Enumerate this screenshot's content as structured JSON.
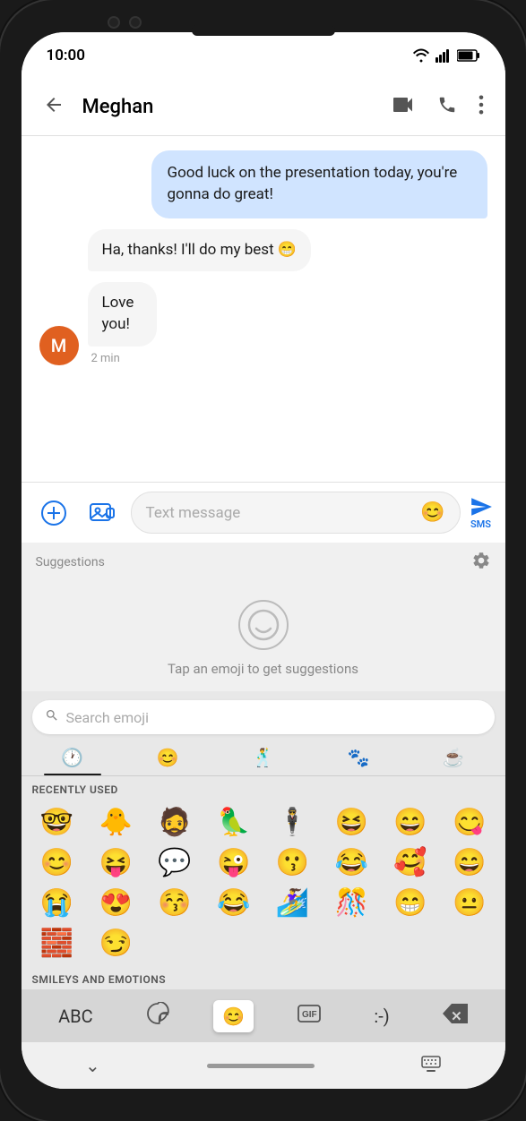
{
  "status_bar": {
    "time": "10:00"
  },
  "top_bar": {
    "title": "Meghan",
    "back_label": "←",
    "video_icon": "📹",
    "phone_icon": "📞",
    "more_icon": "⋮"
  },
  "messages": [
    {
      "id": "msg1",
      "type": "out",
      "text": "Good luck on the presentation today, you're gonna do great!"
    },
    {
      "id": "msg2",
      "type": "in",
      "text": "Ha, thanks! I'll do my best 😁",
      "avatar": "M"
    },
    {
      "id": "msg3",
      "type": "in",
      "text": "Love you!",
      "avatar": "M",
      "time": "2 min"
    }
  ],
  "input_area": {
    "plus_icon": "⊕",
    "image_icon": "🖼",
    "placeholder": "Text message",
    "emoji_icon": "😊",
    "send_label": "SMS"
  },
  "suggestions": {
    "label": "Suggestions",
    "gear_icon": "⚙",
    "hint": "Tap an emoji to get suggestions"
  },
  "emoji_keyboard": {
    "search_placeholder": "Search emoji",
    "category_tabs": [
      {
        "icon": "🕐",
        "label": "recent",
        "active": true
      },
      {
        "icon": "😊",
        "label": "smileys"
      },
      {
        "icon": "🕺",
        "label": "people"
      },
      {
        "icon": "🐾",
        "label": "animals"
      },
      {
        "icon": "☕",
        "label": "food"
      }
    ],
    "recently_used_label": "RECENTLY USED",
    "recently_used": [
      "🤓",
      "🐥",
      "🧔",
      "🦜",
      "🕴",
      "😆",
      "😄",
      "😋",
      "😊",
      "😝",
      "💬",
      "😜",
      "😗",
      "😂",
      "🥰",
      "😄",
      "😭",
      "😍",
      "😚",
      "😂",
      "🏄‍♀",
      "🎊",
      "😁",
      "😐",
      "🧱",
      "😏"
    ],
    "smileys_label": "SMILEYS AND EMOTIONS"
  },
  "keyboard_bottom": {
    "abc_label": "ABC",
    "sticker_label": "",
    "emoji_label": "",
    "gif_label": "",
    "kaomoji_label": ":-)",
    "backspace_label": "⌫"
  },
  "nav_bar": {
    "back": "⌄",
    "home_bar": "",
    "keyboard_icon": "⌨"
  }
}
